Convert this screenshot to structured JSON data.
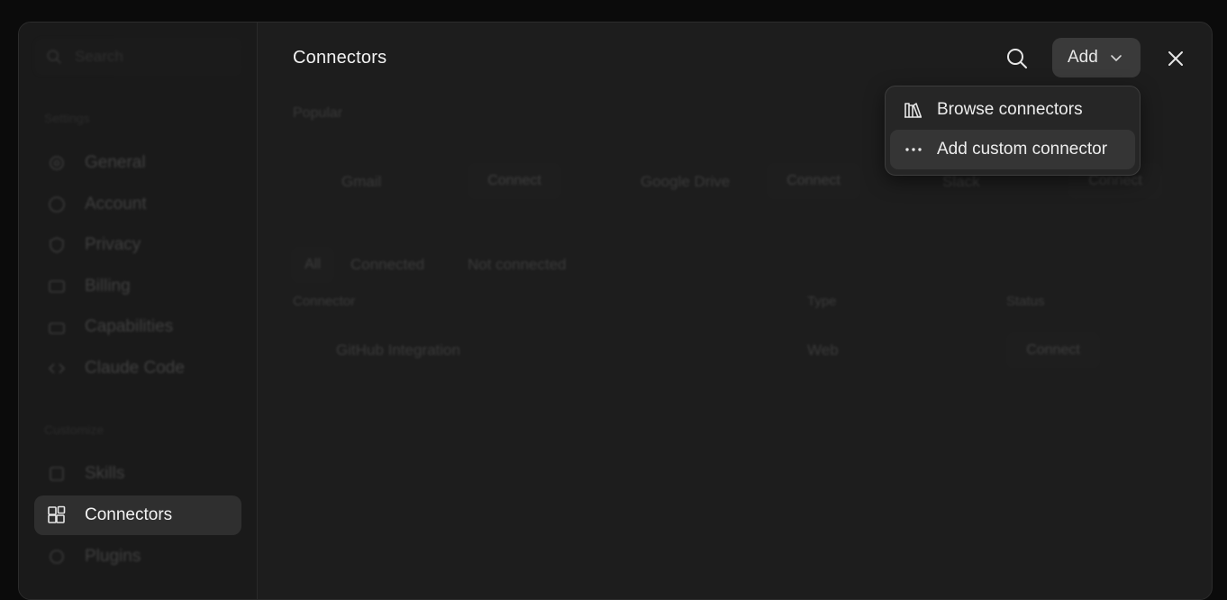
{
  "main": {
    "title": "Connectors",
    "add_button": "Add"
  },
  "add_menu": {
    "items": [
      {
        "label": "Browse connectors",
        "icon": "library-icon"
      },
      {
        "label": "Add custom connector",
        "icon": "more-horizontal-icon"
      }
    ]
  },
  "sidebar": {
    "search_placeholder": "Search",
    "group_settings": "Settings",
    "group_customize": "Customize",
    "items": [
      {
        "label": "General",
        "icon": "gear-icon"
      },
      {
        "label": "Account",
        "icon": "user-circle-icon"
      },
      {
        "label": "Privacy",
        "icon": "shield-icon"
      },
      {
        "label": "Billing",
        "icon": "credit-card-icon"
      },
      {
        "label": "Capabilities",
        "icon": "briefcase-icon"
      },
      {
        "label": "Claude Code",
        "icon": "code-icon"
      },
      {
        "label": "Skills",
        "icon": "skills-icon"
      },
      {
        "label": "Connectors",
        "icon": "connectors-icon",
        "active": true
      },
      {
        "label": "Plugins",
        "icon": "plugin-icon"
      }
    ]
  },
  "background": {
    "popular_label": "Popular",
    "popular": [
      {
        "name": "Gmail",
        "action": "Connect"
      },
      {
        "name": "Google Drive",
        "action": "Connect"
      },
      {
        "name": "Slack",
        "action": "Connect"
      }
    ],
    "filters": [
      "All",
      "Connected",
      "Not connected"
    ],
    "table_headers": {
      "connector": "Connector",
      "type": "Type",
      "status": "Status"
    },
    "rows": [
      {
        "name": "GitHub Integration",
        "type": "Web",
        "action": "Connect"
      }
    ]
  }
}
